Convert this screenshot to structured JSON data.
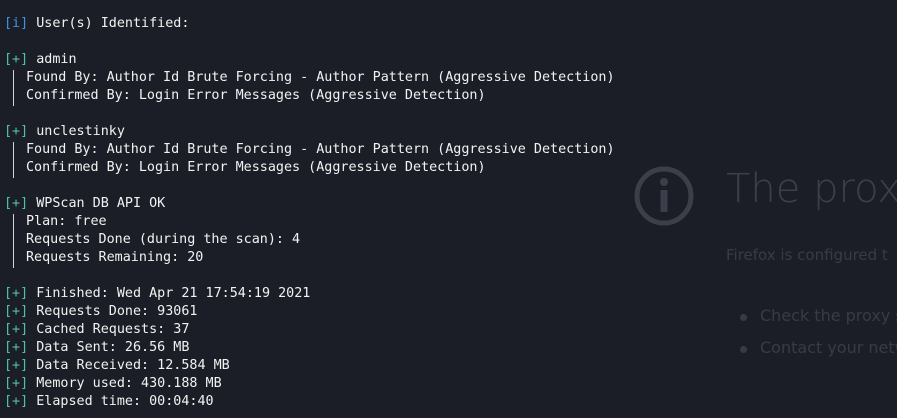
{
  "background_page": {
    "title": "The proxy",
    "description": "Firefox is configured t",
    "suggestions": [
      "Check the proxy s",
      "Contact your netw"
    ]
  },
  "terminal": {
    "header": {
      "tag": "[i]",
      "text": " User(s) Identified:"
    },
    "users": [
      {
        "tag": "[+]",
        "name": " admin",
        "found_by": "Found By: Author Id Brute Forcing - Author Pattern (Aggressive Detection)",
        "confirmed_by": "Confirmed By: Login Error Messages (Aggressive Detection)"
      },
      {
        "tag": "[+]",
        "name": " unclestinky",
        "found_by": "Found By: Author Id Brute Forcing - Author Pattern (Aggressive Detection)",
        "confirmed_by": "Confirmed By: Login Error Messages (Aggressive Detection)"
      }
    ],
    "api": {
      "tag": "[+]",
      "title": " WPScan DB API OK",
      "plan": "Plan: free",
      "requests_done_scan": "Requests Done (during the scan): 4",
      "requests_remaining": "Requests Remaining: 20"
    },
    "summary": [
      {
        "tag": "[+]",
        "text": " Finished: Wed Apr 21 17:54:19 2021"
      },
      {
        "tag": "[+]",
        "text": " Requests Done: 93061"
      },
      {
        "tag": "[+]",
        "text": " Cached Requests: 37"
      },
      {
        "tag": "[+]",
        "text": " Data Sent: 26.56 MB"
      },
      {
        "tag": "[+]",
        "text": " Data Received: 12.584 MB"
      },
      {
        "tag": "[+]",
        "text": " Memory used: 430.188 MB"
      },
      {
        "tag": "[+]",
        "text": " Elapsed time: 00:04:40"
      }
    ]
  },
  "colors": {
    "background": "#1b1e26",
    "info_tag": "#3f8fe6",
    "plus_tag": "#4ec2a4",
    "text": "#f2f2f2"
  },
  "icons": {
    "background_info": "info-circle-icon"
  }
}
